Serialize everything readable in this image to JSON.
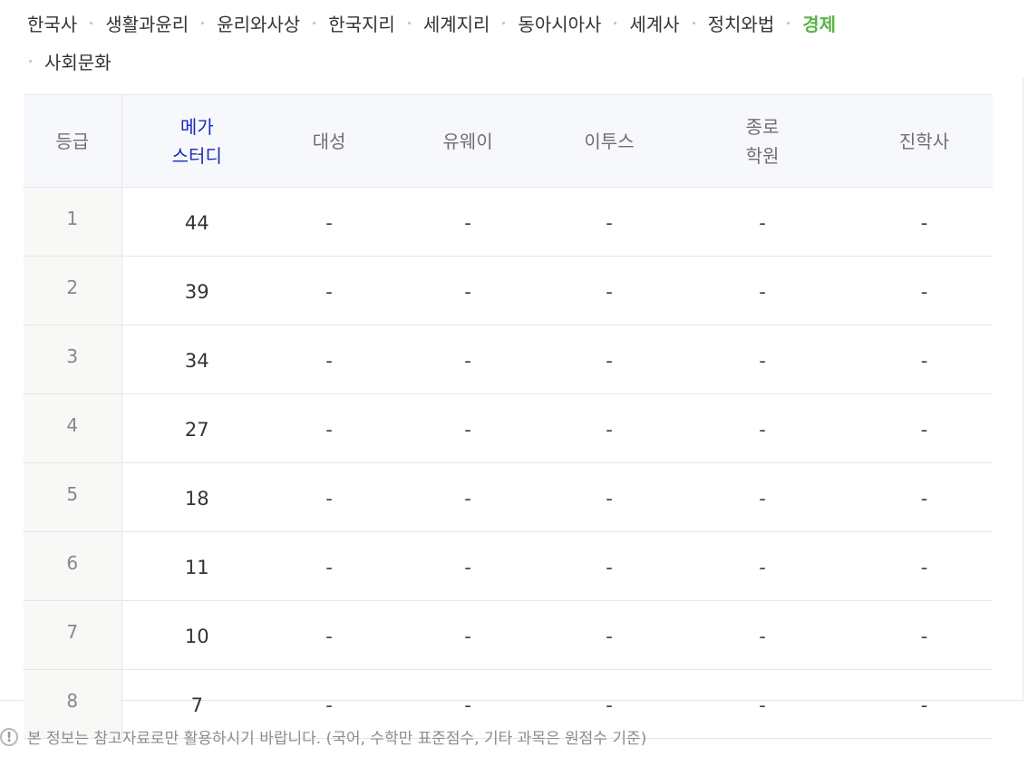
{
  "tabs": [
    {
      "label": "한국사",
      "active": false
    },
    {
      "label": "생활과윤리",
      "active": false
    },
    {
      "label": "윤리와사상",
      "active": false
    },
    {
      "label": "한국지리",
      "active": false
    },
    {
      "label": "세계지리",
      "active": false
    },
    {
      "label": "동아시아사",
      "active": false
    },
    {
      "label": "세계사",
      "active": false
    },
    {
      "label": "정치와법",
      "active": false
    },
    {
      "label": "경제",
      "active": true
    },
    {
      "label": "사회문화",
      "active": false
    }
  ],
  "table": {
    "headers": [
      "등급",
      "메가\n스터디",
      "대성",
      "유웨이",
      "이투스",
      "종로\n학원",
      "진학사"
    ],
    "rows": [
      {
        "grade": "1",
        "values": [
          "44",
          "-",
          "-",
          "-",
          "-",
          "-"
        ]
      },
      {
        "grade": "2",
        "values": [
          "39",
          "-",
          "-",
          "-",
          "-",
          "-"
        ]
      },
      {
        "grade": "3",
        "values": [
          "34",
          "-",
          "-",
          "-",
          "-",
          "-"
        ]
      },
      {
        "grade": "4",
        "values": [
          "27",
          "-",
          "-",
          "-",
          "-",
          "-"
        ]
      },
      {
        "grade": "5",
        "values": [
          "18",
          "-",
          "-",
          "-",
          "-",
          "-"
        ]
      },
      {
        "grade": "6",
        "values": [
          "11",
          "-",
          "-",
          "-",
          "-",
          "-"
        ]
      },
      {
        "grade": "7",
        "values": [
          "10",
          "-",
          "-",
          "-",
          "-",
          "-"
        ]
      },
      {
        "grade": "8",
        "values": [
          "7",
          "-",
          "-",
          "-",
          "-",
          "-"
        ]
      }
    ]
  },
  "notice": {
    "icon": "exclamation-circle-icon",
    "text": "본 정보는 참고자료로만 활용하시기 바랍니다. (국어, 수학만 표준점수, 기타 과목은 원점수 기준)"
  },
  "colors": {
    "active_tab": "#5ab446",
    "highlight_header": "#1a2bb8"
  }
}
